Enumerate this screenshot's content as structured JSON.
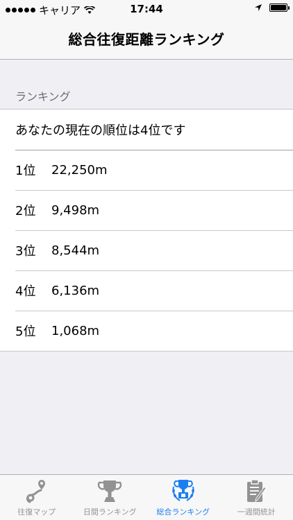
{
  "status_bar": {
    "carrier": "キャリア",
    "time": "17:44"
  },
  "nav": {
    "title": "総合往復距離ランキング"
  },
  "section": {
    "header": "ランキング"
  },
  "my_rank": "あなたの現在の順位は4位です",
  "rankings": [
    {
      "rank": "1位",
      "distance": "22,250m"
    },
    {
      "rank": "2位",
      "distance": "9,498m"
    },
    {
      "rank": "3位",
      "distance": "8,544m"
    },
    {
      "rank": "4位",
      "distance": "6,136m"
    },
    {
      "rank": "5位",
      "distance": "1,068m"
    }
  ],
  "tabs": [
    {
      "label": "往復マップ",
      "icon": "map-pin-icon",
      "active": false
    },
    {
      "label": "日間ランキング",
      "icon": "trophy-icon",
      "active": false
    },
    {
      "label": "総合ランキング",
      "icon": "trophy-laurel-icon",
      "active": true
    },
    {
      "label": "一週間統計",
      "icon": "clipboard-pen-icon",
      "active": false
    }
  ],
  "colors": {
    "accent": "#1a7ff0",
    "inactive": "#929292"
  }
}
